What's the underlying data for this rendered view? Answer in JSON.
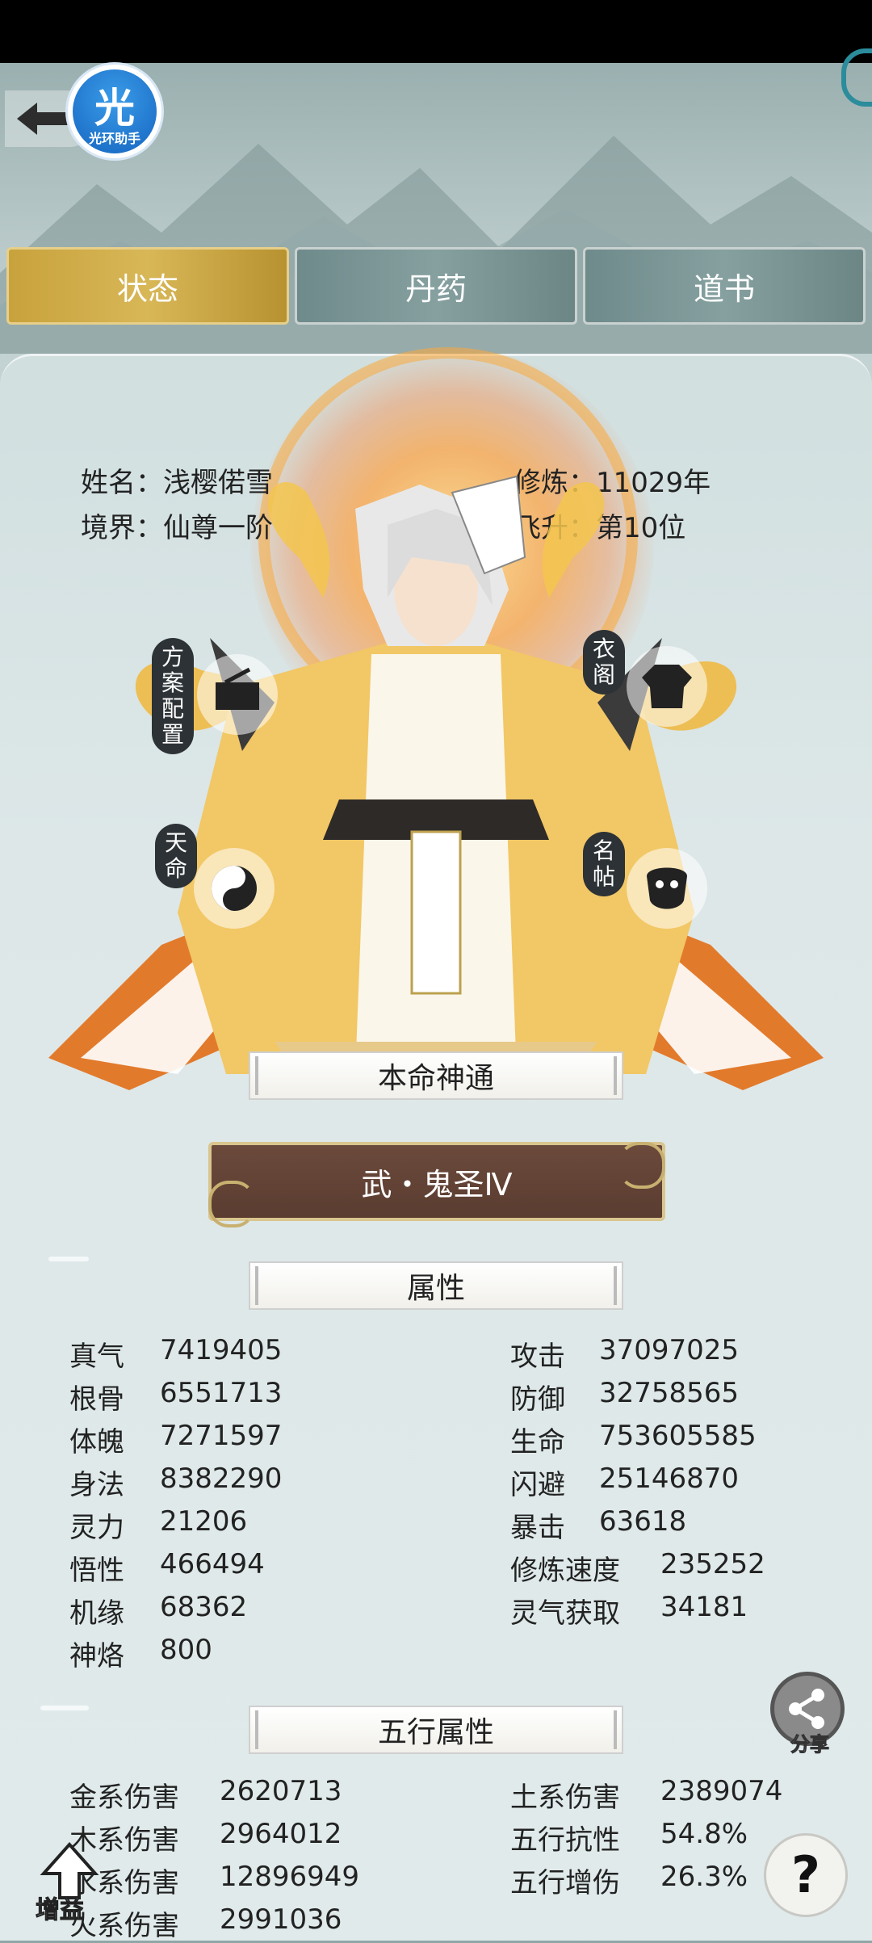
{
  "assistant": {
    "big": "光",
    "small": "光环助手"
  },
  "tabs": [
    {
      "label": "状态",
      "active": true
    },
    {
      "label": "丹药",
      "active": false
    },
    {
      "label": "道书",
      "active": false
    }
  ],
  "character": {
    "name_label": "姓名：",
    "name": "浅樱偌雪",
    "realm_label": "境界：",
    "realm": "仙尊一阶",
    "cultivation_label": "修炼：",
    "cultivation": "11029年",
    "ascension_label": "飞升：",
    "ascension": "第10位"
  },
  "side_buttons": {
    "scheme": "方案配置",
    "wardrobe": "衣阁",
    "destiny": "天命",
    "title_card": "名帖"
  },
  "natal_section": {
    "title": "本命神通",
    "skill": "武・鬼圣Ⅳ"
  },
  "attributes": {
    "title": "属性",
    "left": [
      {
        "name": "真气",
        "value": "7419405"
      },
      {
        "name": "根骨",
        "value": "6551713"
      },
      {
        "name": "体魄",
        "value": "7271597"
      },
      {
        "name": "身法",
        "value": "8382290"
      },
      {
        "name": "灵力",
        "value": "21206"
      },
      {
        "name": "悟性",
        "value": "466494"
      },
      {
        "name": "机缘",
        "value": "68362"
      },
      {
        "name": "神烙",
        "value": "800"
      }
    ],
    "right": [
      {
        "name": "攻击",
        "value": "37097025"
      },
      {
        "name": "防御",
        "value": "32758565"
      },
      {
        "name": "生命",
        "value": "753605585"
      },
      {
        "name": "闪避",
        "value": "25146870"
      },
      {
        "name": "暴击",
        "value": "63618"
      },
      {
        "name": "修炼速度",
        "value": "235252"
      },
      {
        "name": "灵气获取",
        "value": "34181"
      }
    ]
  },
  "five_elements": {
    "title": "五行属性",
    "left": [
      {
        "name": "金系伤害",
        "value": "2620713"
      },
      {
        "name": "木系伤害",
        "value": "2964012"
      },
      {
        "name": "水系伤害",
        "value": "12896949"
      },
      {
        "name": "火系伤害",
        "value": "2991036"
      }
    ],
    "right": [
      {
        "name": "土系伤害",
        "value": "2389074"
      },
      {
        "name": "五行抗性",
        "value": "54.8%"
      },
      {
        "name": "五行增伤",
        "value": "26.3%"
      }
    ]
  },
  "floating": {
    "share": "分享",
    "help": "?",
    "boost": "增益"
  },
  "colors": {
    "active_tab": "#c8a23c",
    "inactive_tab": "#7a9494",
    "fate_button": "#5f4234",
    "assistant_blue": "#1e7fd8"
  }
}
